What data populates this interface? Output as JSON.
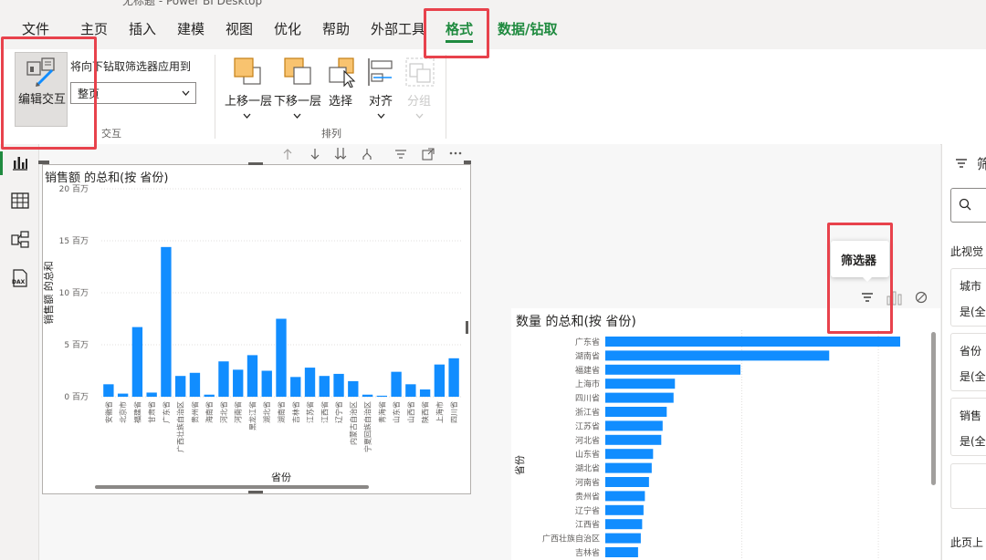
{
  "window": {
    "title": "无标题 - Power BI Desktop"
  },
  "tabs": [
    {
      "label": "文件"
    },
    {
      "label": "主页"
    },
    {
      "label": "插入"
    },
    {
      "label": "建模"
    },
    {
      "label": "视图"
    },
    {
      "label": "优化"
    },
    {
      "label": "帮助"
    },
    {
      "label": "外部工具"
    },
    {
      "label": "格式"
    },
    {
      "label": "数据/钻取"
    }
  ],
  "ribbon": {
    "edit_interactions": "编辑交互",
    "drill_filter_label": "将向下钻取筛选器应用到",
    "drill_filter_value": "整页",
    "group_interaction": "交互",
    "bring_forward": "上移一层",
    "send_backward": "下移一层",
    "select": "选择",
    "align": "对齐",
    "group": "分组",
    "group_arrange": "排列"
  },
  "colors": {
    "accent": "#1f8a3f",
    "bar": "#118dff",
    "highlight_box": "#e8424c"
  },
  "visual_toolbar_icons": [
    "arrow-up-icon",
    "arrow-down-icon",
    "double-arrow-down-icon",
    "fork-icon",
    "filter-icon",
    "focus-mode-icon",
    "more-options-icon"
  ],
  "chart_data": [
    {
      "type": "bar",
      "title": "销售额 的总和(按 省份)",
      "xlabel": "省份",
      "ylabel": "销售额 的总和",
      "ylim": [
        0,
        20000000
      ],
      "y_ticks": [
        "0 百万",
        "5 百万",
        "10 百万",
        "15 百万",
        "20 百万"
      ],
      "categories": [
        "安徽省",
        "北京市",
        "福建省",
        "甘肃省",
        "广东省",
        "广西壮族自治区",
        "贵州省",
        "海南省",
        "河北省",
        "河南省",
        "黑龙江省",
        "湖北省",
        "湖南省",
        "吉林省",
        "江苏省",
        "江西省",
        "辽宁省",
        "内蒙古自治区",
        "宁夏回族自治区",
        "青海省",
        "山东省",
        "山西省",
        "陕西省",
        "上海市",
        "四川省"
      ],
      "values": [
        1200000,
        300000,
        6700000,
        400000,
        14400000,
        2000000,
        2300000,
        200000,
        3400000,
        2600000,
        4000000,
        2500000,
        7500000,
        1900000,
        2800000,
        2000000,
        2200000,
        1500000,
        200000,
        100000,
        2400000,
        1200000,
        700000,
        3100000,
        3700000
      ]
    },
    {
      "type": "bar",
      "orientation": "horizontal",
      "title": "数量 的总和(按 省份)",
      "ylabel": "省份",
      "categories": [
        "广东省",
        "湖南省",
        "福建省",
        "上海市",
        "四川省",
        "浙江省",
        "江苏省",
        "河北省",
        "山东省",
        "湖北省",
        "河南省",
        "贵州省",
        "辽宁省",
        "江西省",
        "广西壮族自治区",
        "吉林省"
      ],
      "values": [
        10800,
        8200,
        4950,
        2550,
        2500,
        2250,
        2100,
        2050,
        1750,
        1700,
        1600,
        1450,
        1400,
        1350,
        1300,
        1200
      ]
    }
  ],
  "tooltip": {
    "text": "筛选器"
  },
  "filter_pane": {
    "title": "筛",
    "section_visual": "此视觉",
    "cards": [
      {
        "field": "城市",
        "value": "是(全"
      },
      {
        "field": "省份",
        "value": "是(全"
      },
      {
        "field": "销售",
        "value": "是(全"
      }
    ],
    "section_page": "此页上"
  }
}
